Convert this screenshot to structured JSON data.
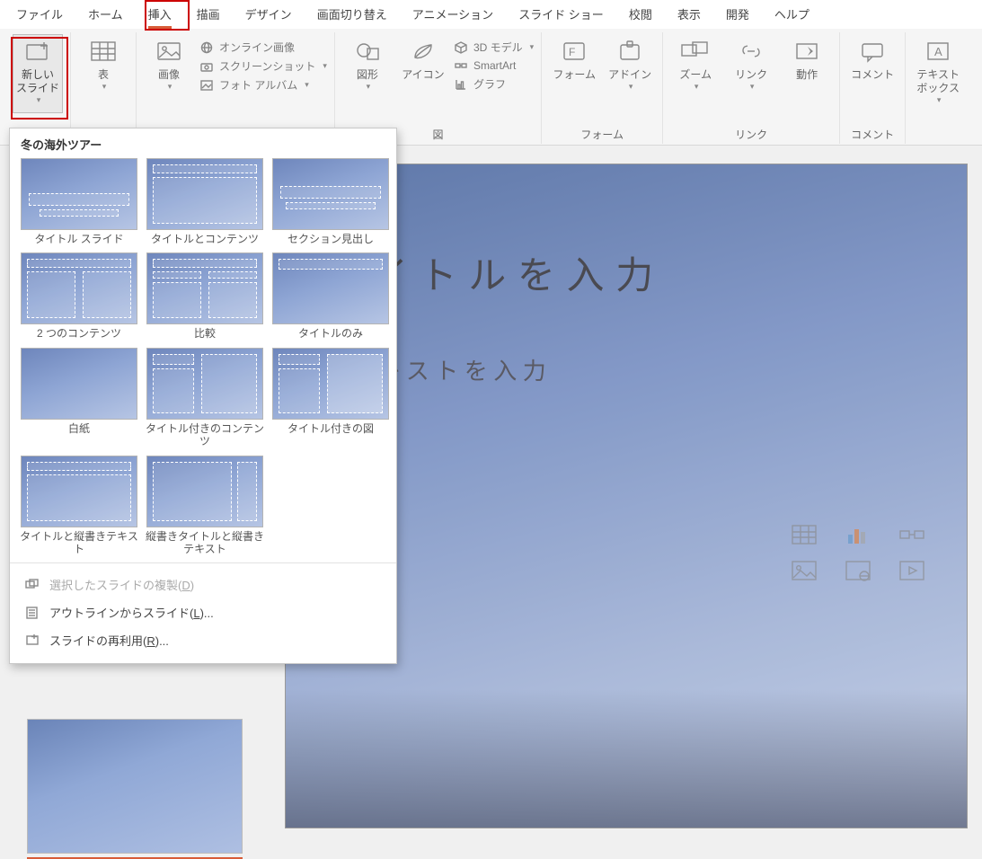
{
  "tabs": {
    "file": "ファイル",
    "home": "ホーム",
    "insert": "挿入",
    "draw": "描画",
    "design": "デザイン",
    "transition": "画面切り替え",
    "animation": "アニメーション",
    "slideshow": "スライド ショー",
    "review": "校閲",
    "view": "表示",
    "developer": "開発",
    "help": "ヘルプ"
  },
  "ribbon": {
    "new_slide": "新しい\nスライド",
    "table": "表",
    "images": "画像",
    "online_images": "オンライン画像",
    "screenshot": "スクリーンショット",
    "photo_album": "フォト アルバム",
    "shapes": "図形",
    "icons": "アイコン",
    "3d": "3D モデル",
    "smartart": "SmartArt",
    "chart": "グラフ",
    "forms": "フォーム",
    "addins": "アドイン",
    "zoom": "ズーム",
    "link": "リンク",
    "action": "動作",
    "comment": "コメント",
    "textbox": "テキスト\nボックス",
    "grp_illust": "図",
    "grp_forms": "フォーム",
    "grp_links": "リンク",
    "grp_comment": "コメント"
  },
  "gallery": {
    "title": "冬の海外ツアー",
    "layouts": [
      "タイトル スライド",
      "タイトルとコンテンツ",
      "セクション見出し",
      "2 つのコンテンツ",
      "比較",
      "タイトルのみ",
      "白紙",
      "タイトル付きのコンテンツ",
      "タイトル付きの図",
      "タイトルと縦書きテキスト",
      "縦書きタイトルと縦書きテキスト"
    ],
    "menu": {
      "duplicate_pre": "選択したスライドの複製(",
      "duplicate_key": "D",
      "duplicate_post": ")",
      "outline_pre": "アウトラインからスライド(",
      "outline_key": "L",
      "outline_post": ")...",
      "reuse_pre": "スライドの再利用(",
      "reuse_key": "R",
      "reuse_post": ")..."
    }
  },
  "slide": {
    "title": "タイトルを入力",
    "body": "テキストを入力"
  }
}
